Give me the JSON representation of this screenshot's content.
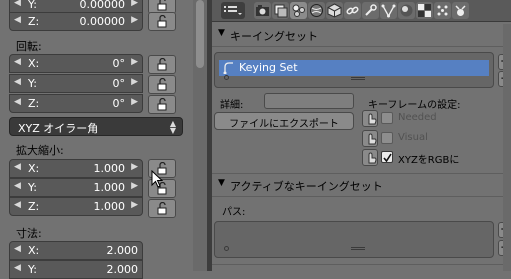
{
  "left_panel": {
    "location_y": {
      "label": "Y:",
      "value": "0.00000"
    },
    "location_z": {
      "label": "Z:",
      "value": "0.00000"
    },
    "rotation_title": "回転:",
    "rotation": [
      {
        "label": "X:",
        "value": "0°"
      },
      {
        "label": "Y:",
        "value": "0°"
      },
      {
        "label": "Z:",
        "value": "0°"
      }
    ],
    "rotation_mode": "XYZ オイラー角",
    "scale_title": "拡大縮小:",
    "scale": [
      {
        "label": "X:",
        "value": "1.000"
      },
      {
        "label": "Y:",
        "value": "1.000"
      },
      {
        "label": "Z:",
        "value": "1.000"
      }
    ],
    "dimensions_title": "寸法:",
    "dimensions": [
      {
        "label": "X:",
        "value": "2.000"
      },
      {
        "label": "Y:",
        "value": "2.000"
      }
    ]
  },
  "properties_tabs": [
    "render-icon",
    "render-layers-icon",
    "scene-icon",
    "world-icon",
    "object-icon",
    "constraints-icon",
    "modifiers-icon",
    "data-icon",
    "material-icon",
    "texture-icon",
    "physics-icon"
  ],
  "keying_sets_panel": {
    "title": "キーイングセット",
    "items": [
      "Keying Set"
    ],
    "add": "+",
    "remove": "−"
  },
  "keying_set_details": {
    "description_label": "詳細:",
    "description_value": "",
    "export_button": "ファイルにエクスポート",
    "keyframe_settings_title": "キーフレームの設定:",
    "options": [
      {
        "label": "Needed",
        "checked": false,
        "enabled": false
      },
      {
        "label": "Visual",
        "checked": false,
        "enabled": false
      },
      {
        "label": "XYZをRGBに",
        "checked": true,
        "enabled": true
      }
    ]
  },
  "active_keying_set_panel": {
    "title": "アクティブなキーイングセット",
    "paths_label": "パス:",
    "add": "+",
    "remove": "−"
  },
  "colors": {
    "panel_bg": "#727272",
    "field_bg": "#595959",
    "selection": "#5680c2",
    "header_bg": "#5a5a5a"
  }
}
